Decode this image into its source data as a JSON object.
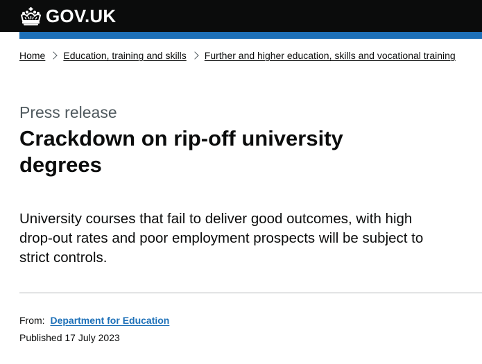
{
  "header": {
    "logo_text": "GOV.UK",
    "logo_icon": "crown-icon",
    "background_color": "#0b0c0c",
    "accent_bar_color": "#1d70b8"
  },
  "breadcrumbs": [
    {
      "label": "Home"
    },
    {
      "label": "Education, training and skills"
    },
    {
      "label": "Further and higher education, skills and vocational training"
    }
  ],
  "page": {
    "caption": "Press release",
    "title": "Crackdown on rip-off university degrees",
    "lead": "University courses that fail to deliver good outcomes, with high drop-out rates and poor employment prospects will be subject to strict controls."
  },
  "metadata": {
    "from_label": "From:",
    "from_org": "Department for Education",
    "published_label": "Published",
    "published_date": "17 July 2023",
    "link_color": "#1d70b8"
  }
}
